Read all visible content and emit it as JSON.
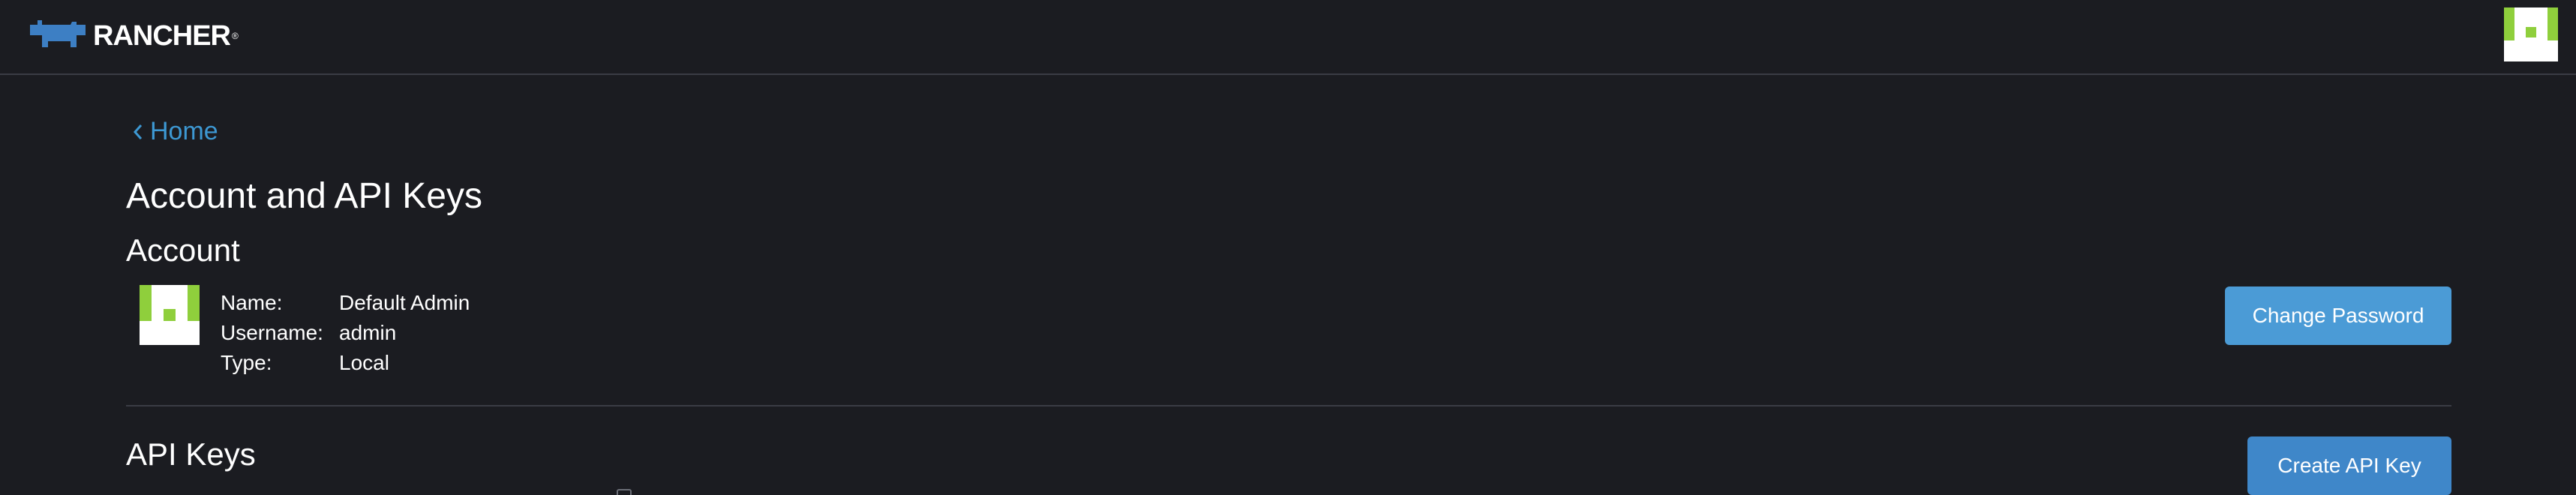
{
  "header": {
    "logo_text": "RANCHER",
    "logo_tm": "®",
    "colors": {
      "background": "#1b1c21",
      "logo_blue": "#3d7fc4"
    }
  },
  "nav": {
    "back_label": "Home",
    "back_icon": "chevron-left-icon"
  },
  "page": {
    "title": "Account and API Keys"
  },
  "account": {
    "section_title": "Account",
    "fields": [
      {
        "key": "Name:",
        "value": "Default Admin"
      },
      {
        "key": "Username:",
        "value": "admin"
      },
      {
        "key": "Type:",
        "value": "Local"
      }
    ],
    "change_password_label": "Change Password",
    "avatar_colors": {
      "green": "#8fcf3c",
      "white": "#ffffff"
    }
  },
  "api_keys": {
    "section_title": "API Keys",
    "create_label": "Create API Key"
  },
  "colors": {
    "link": "#3d98d3",
    "primary_button": "#4b9bd6",
    "divider": "#3a3c44"
  }
}
